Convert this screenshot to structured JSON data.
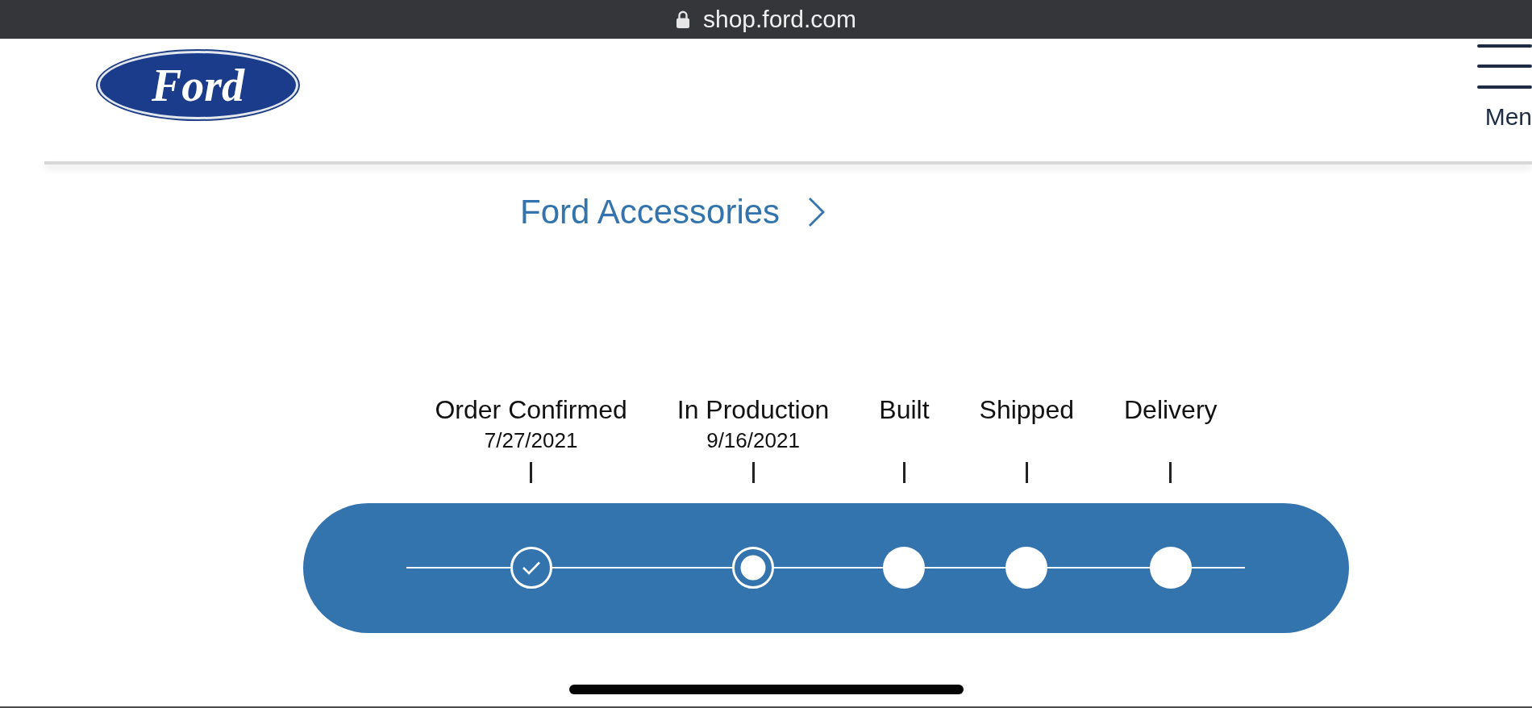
{
  "browser_bar": {
    "url": "shop.ford.com"
  },
  "header": {
    "logo": {
      "text": "Ford"
    },
    "menu_button": {
      "label": "Men"
    }
  },
  "accessories_link": {
    "label": "Ford Accessories"
  },
  "progress_tracker": {
    "steps": [
      {
        "label": "Order Confirmed",
        "date": "7/27/2021",
        "completed": true,
        "selected": false
      },
      {
        "label": "In Production",
        "date": "9/16/2021",
        "completed": false,
        "selected": true
      },
      {
        "label": "Built",
        "completed": false,
        "selected": false
      },
      {
        "label": "Shipped",
        "completed": false,
        "selected": false
      },
      {
        "label": "Delivery",
        "completed": false,
        "selected": false
      }
    ]
  }
}
